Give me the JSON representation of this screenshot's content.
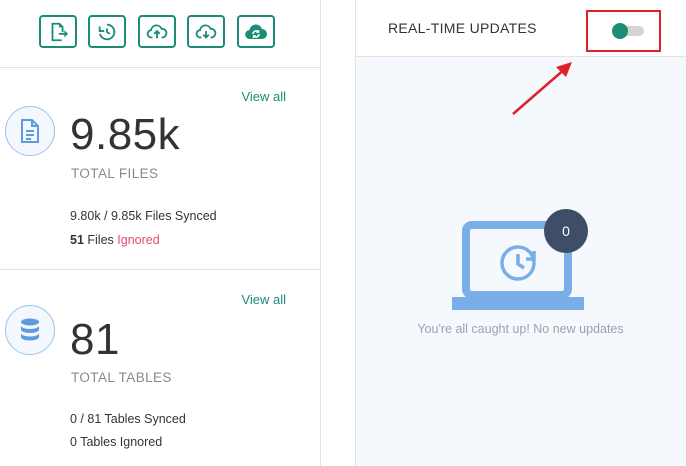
{
  "toolbar": {
    "buttons": [
      {
        "icon": "file-export-icon"
      },
      {
        "icon": "history-restore-icon"
      },
      {
        "icon": "cloud-upload-icon"
      },
      {
        "icon": "cloud-download-icon"
      },
      {
        "icon": "cloud-sync-icon"
      }
    ],
    "accent_color": "#1c8c78"
  },
  "files_card": {
    "view_all": "View all",
    "icon": "document-icon",
    "count": "9.85k",
    "label": "TOTAL FILES",
    "synced_count": "9.80k / 9.85k",
    "synced_text": "Files Synced",
    "ignored_count": "51",
    "ignored_files_word": "Files",
    "ignored_text": "Ignored",
    "ignored_color": "#e0506a"
  },
  "tables_card": {
    "view_all": "View all",
    "icon": "database-icon",
    "count": "81",
    "label": "TOTAL TABLES",
    "synced_count": "0 / 81",
    "synced_text": "Tables Synced",
    "ignored_count": "0",
    "ignored_text": "Tables Ignored"
  },
  "updates": {
    "title": "REAL-TIME UPDATES",
    "toggle_on": false,
    "badge_count": "0",
    "empty_message": "You're all caught up! No new updates",
    "highlight_color": "#e0202a"
  }
}
